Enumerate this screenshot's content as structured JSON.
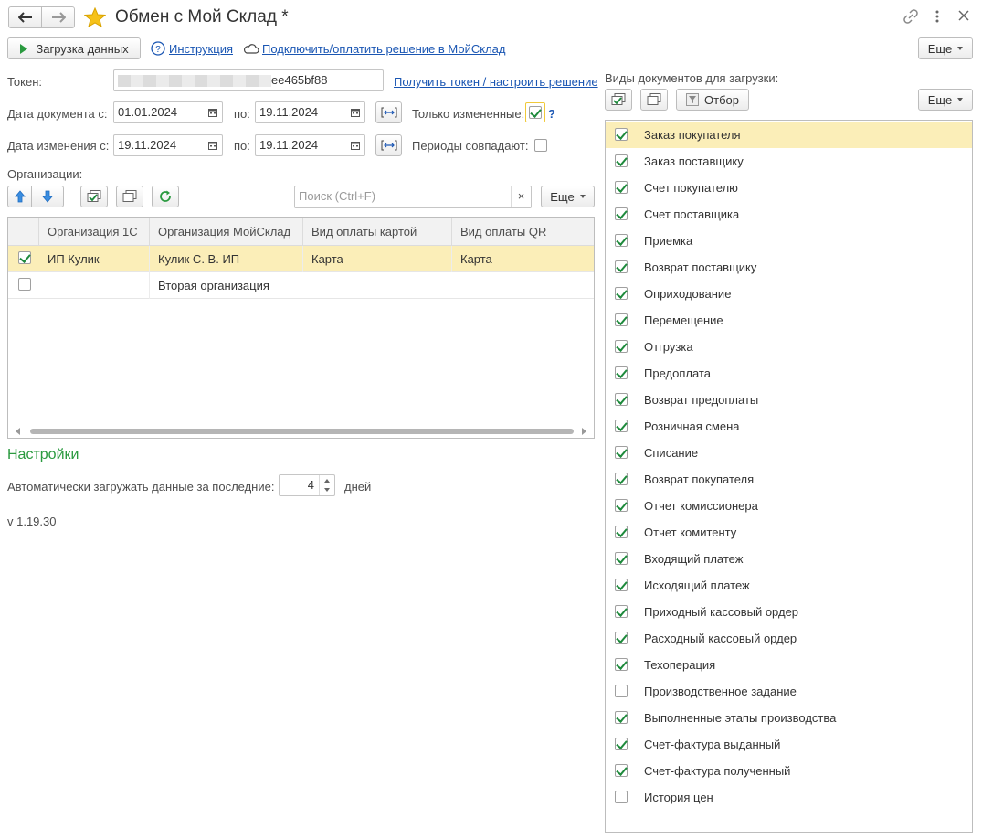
{
  "window": {
    "title": "Обмен с Мой Склад *"
  },
  "toolbar": {
    "load_label": "Загрузка данных",
    "instruction_label": "Инструкция",
    "connect_label": "Подключить/оплатить решение в МойСклад",
    "more_label": "Еще"
  },
  "form": {
    "token_label": "Токен:",
    "token_value_visible": "ee465bf88",
    "token_link": "Получить токен / настроить решение",
    "doc_date_label": "Дата документа с:",
    "doc_date_from": "01.01.2024",
    "doc_date_to_label": "по:",
    "doc_date_to": "19.11.2024",
    "only_changed_label": "Только измененные:",
    "only_changed_help": "?",
    "only_changed_checked": true,
    "change_date_label": "Дата изменения с:",
    "change_date_from": "19.11.2024",
    "change_date_to_label": "по:",
    "change_date_to": "19.11.2024",
    "periods_match_label": "Периоды совпадают:",
    "periods_match_checked": false
  },
  "orgs": {
    "label": "Организации:",
    "search_placeholder": "Поиск (Ctrl+F)",
    "more_label": "Еще",
    "columns": [
      "Организация 1С",
      "Организация МойСклад",
      "Вид оплаты картой",
      "Вид оплаты QR"
    ],
    "rows": [
      {
        "checked": true,
        "org1c": "ИП Кулик",
        "org_ms": "Кулик С. В. ИП",
        "card": "Карта",
        "qr": "Карта"
      },
      {
        "checked": false,
        "org1c": "",
        "org_ms": "Вторая организация",
        "card": "",
        "qr": ""
      }
    ]
  },
  "settings": {
    "title": "Настройки",
    "auto_load_label": "Автоматически загружать данные за последние:",
    "auto_load_value": "4",
    "days_label": "дней",
    "version": "v 1.19.30"
  },
  "docs": {
    "label": "Виды документов для загрузки:",
    "filter_label": "Отбор",
    "more_label": "Еще",
    "items": [
      {
        "label": "Заказ покупателя",
        "checked": true
      },
      {
        "label": "Заказ поставщику",
        "checked": true
      },
      {
        "label": "Счет покупателю",
        "checked": true
      },
      {
        "label": "Счет поставщика",
        "checked": true
      },
      {
        "label": "Приемка",
        "checked": true
      },
      {
        "label": "Возврат поставщику",
        "checked": true
      },
      {
        "label": "Оприходование",
        "checked": true
      },
      {
        "label": "Перемещение",
        "checked": true
      },
      {
        "label": "Отгрузка",
        "checked": true
      },
      {
        "label": "Предоплата",
        "checked": true
      },
      {
        "label": "Возврат предоплаты",
        "checked": true
      },
      {
        "label": "Розничная смена",
        "checked": true
      },
      {
        "label": "Списание",
        "checked": true
      },
      {
        "label": "Возврат покупателя",
        "checked": true
      },
      {
        "label": "Отчет комиссионера",
        "checked": true
      },
      {
        "label": "Отчет комитенту",
        "checked": true
      },
      {
        "label": "Входящий платеж",
        "checked": true
      },
      {
        "label": "Исходящий платеж",
        "checked": true
      },
      {
        "label": "Приходный кассовый ордер",
        "checked": true
      },
      {
        "label": "Расходный кассовый ордер",
        "checked": true
      },
      {
        "label": "Техоперация",
        "checked": true
      },
      {
        "label": "Производственное задание",
        "checked": false
      },
      {
        "label": "Выполненные этапы производства",
        "checked": true
      },
      {
        "label": "Счет-фактура выданный",
        "checked": true
      },
      {
        "label": "Счет-фактура полученный",
        "checked": true
      },
      {
        "label": "История цен",
        "checked": false
      }
    ]
  },
  "colors": {
    "accent_green": "#1e8a3c",
    "selected_row": "#fbeeb8",
    "link_blue": "#1a56b3"
  }
}
